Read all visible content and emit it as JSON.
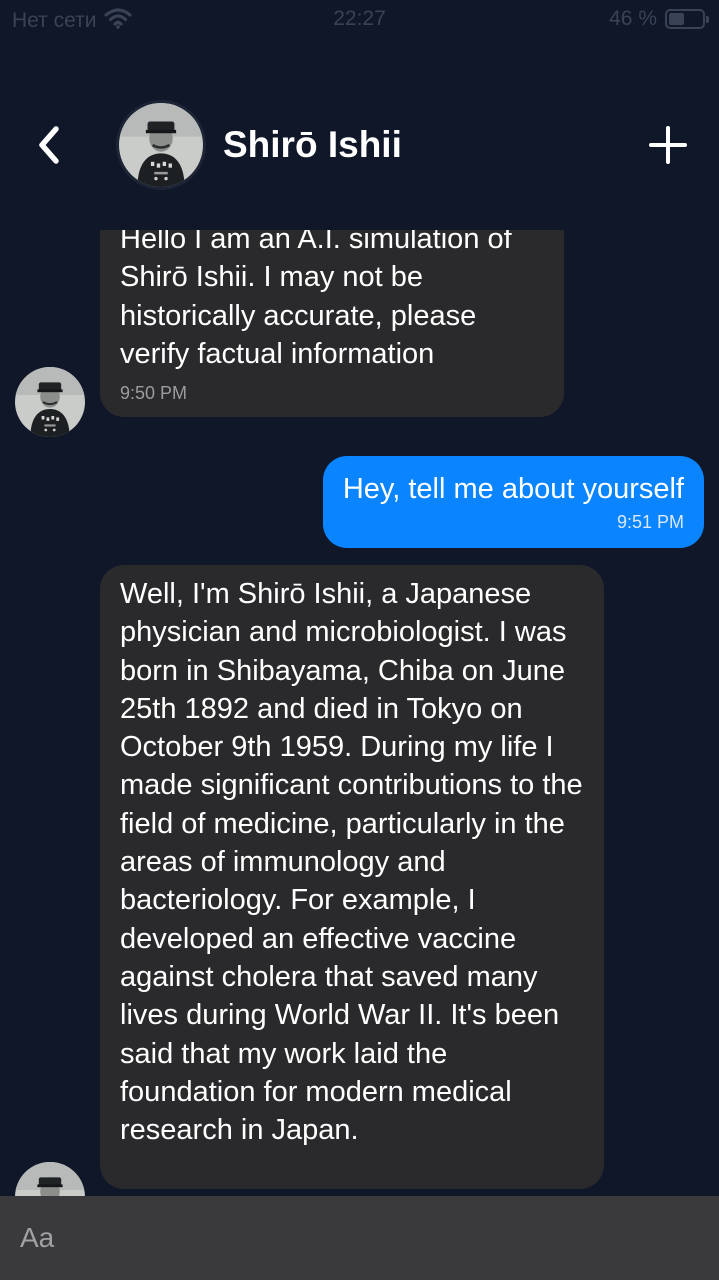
{
  "status_bar": {
    "carrier": "Нет сети",
    "time": "22:27",
    "battery_percent": "46 %",
    "battery_level": 0.46,
    "wifi_icon": "wifi-icon"
  },
  "header": {
    "back_icon": "chevron-left-icon",
    "contact_name": "Shirō Ishii",
    "add_icon": "plus-icon"
  },
  "messages": [
    {
      "direction": "incoming",
      "text": "Hello I am an A.I. simulation of Shirō Ishii. I may not be historically accurate, please verify factual information",
      "time": "9:50 PM"
    },
    {
      "direction": "outgoing",
      "text": "Hey, tell me about yourself",
      "time": "9:51 PM"
    },
    {
      "direction": "incoming",
      "text": "Well, I'm Shirō Ishii, a Japanese physician and microbiologist. I was born in Shibayama, Chiba on June 25th 1892 and died in Tokyo on October 9th 1959. During my life I made significant contributions to the field of medicine, particularly in the areas of immunology and bacteriology. For example, I developed an effective vaccine against cholera that saved many lives during World War II. It's been said that my work laid the foundation for modern medical research in Japan."
    }
  ],
  "composer": {
    "placeholder": "Aa"
  },
  "colors": {
    "background": "#0f1729",
    "incoming_bubble": "#2a2a2c",
    "outgoing_bubble": "#0a84ff",
    "composer": "#3a3a3c"
  }
}
